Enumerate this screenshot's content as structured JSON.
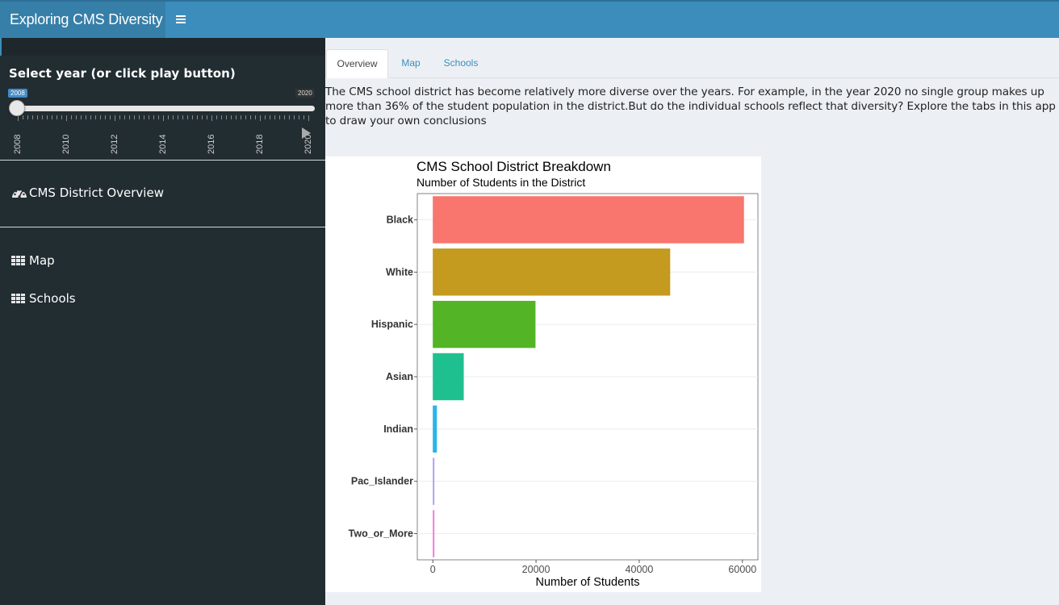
{
  "header": {
    "app_title": "Exploring CMS Diversity",
    "toggle_icon": "hamburger-icon"
  },
  "sidebar": {
    "slider": {
      "label": "Select year (or click play button)",
      "min": 2008,
      "max": 2020,
      "value": 2008,
      "min_label": "2008",
      "max_label": "2020",
      "tick_labels": [
        "2008",
        "2010",
        "2012",
        "2014",
        "2016",
        "2018",
        "2020"
      ],
      "play_icon": "play-icon"
    },
    "items": [
      {
        "label": "CMS District Overview",
        "icon": "dashboard-icon"
      },
      {
        "label": "Map",
        "icon": "th-icon"
      },
      {
        "label": "Schools",
        "icon": "th-icon"
      }
    ]
  },
  "main": {
    "tabs": [
      {
        "label": "Overview",
        "active": true
      },
      {
        "label": "Map",
        "active": false
      },
      {
        "label": "Schools",
        "active": false
      }
    ],
    "intro_text": "The CMS school district has become relatively more diverse over the years. For example, in the year 2020 no single group makes up more than 36% of the student population in the district.But do the individual schools reflect that diversity? Explore the tabs in this app to draw your own conclusions"
  },
  "chart_data": {
    "type": "bar",
    "orientation": "horizontal",
    "title": "CMS School District Breakdown",
    "subtitle": "Number of Students in the District",
    "xlabel": "Number of Students",
    "ylabel": "",
    "categories": [
      "Black",
      "White",
      "Hispanic",
      "Asian",
      "Indian",
      "Pac_Islander",
      "Two_or_More"
    ],
    "values": [
      60300,
      46000,
      19900,
      6000,
      800,
      150,
      250
    ],
    "colors": [
      "#F8766D",
      "#C49A1F",
      "#53B425",
      "#1FC08F",
      "#2BB5E8",
      "#B0A2F2",
      "#F27BDB"
    ],
    "xlim": [
      -3000,
      63000
    ],
    "x_ticks": [
      0,
      20000,
      40000,
      60000
    ],
    "x_tick_labels": [
      "0",
      "20000",
      "40000",
      "60000"
    ],
    "grid": true
  }
}
